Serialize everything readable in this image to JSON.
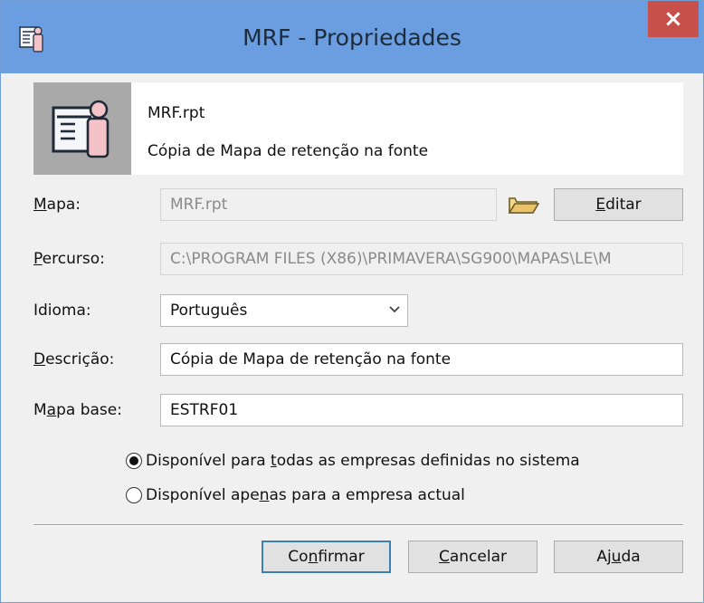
{
  "window": {
    "title": "MRF - Propriedades",
    "close_symbol": "×",
    "app_icon": "report-properties-icon"
  },
  "header": {
    "icon": "report-icon",
    "filename": "MRF.rpt",
    "description": "Cópia de Mapa de retenção na fonte"
  },
  "form": {
    "mapa": {
      "label_pre": "",
      "label_u": "M",
      "label_post": "apa:",
      "value": "MRF.rpt",
      "browse_icon": "folder-open-icon",
      "edit_button_u": "E",
      "edit_button_post": "ditar"
    },
    "percurso": {
      "label_pre": "",
      "label_u": "P",
      "label_post": "ercurso:",
      "value": "C:\\PROGRAM FILES (X86)\\PRIMAVERA\\SG900\\MAPAS\\LE\\M"
    },
    "idioma": {
      "label": "Idioma:",
      "value": "Português"
    },
    "descricao": {
      "label_pre": "",
      "label_u": "D",
      "label_post": "escrição:",
      "value": "Cópia de Mapa de retenção na fonte"
    },
    "mapa_base": {
      "label_pre": "M",
      "label_u": "a",
      "label_post": "pa base:",
      "value": "ESTRF01"
    },
    "availability": {
      "option_all_pre": "Disponível para ",
      "option_all_u": "t",
      "option_all_post": "odas as empresas definidas no sistema",
      "option_current_pre": "Disponível ape",
      "option_current_u": "n",
      "option_current_post": "as para a empresa actual",
      "selected": "all"
    }
  },
  "buttons": {
    "confirm_pre": "Co",
    "confirm_u": "n",
    "confirm_post": "firmar",
    "cancel_pre": "",
    "cancel_u": "C",
    "cancel_post": "ancelar",
    "help_pre": "Aj",
    "help_u": "u",
    "help_post": "da"
  }
}
